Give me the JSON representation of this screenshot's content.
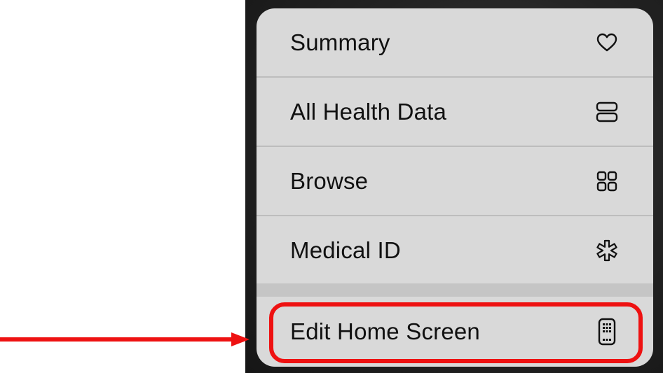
{
  "menu": {
    "items": [
      {
        "label": "Summary",
        "icon": "heart-icon"
      },
      {
        "label": "All Health Data",
        "icon": "stacked-rows-icon"
      },
      {
        "label": "Browse",
        "icon": "grid-icon"
      },
      {
        "label": "Medical ID",
        "icon": "medical-star-icon"
      }
    ],
    "action": {
      "label": "Edit Home Screen",
      "icon": "phone-icon"
    }
  },
  "annotation": {
    "color": "#ee1111",
    "target": "Edit Home Screen"
  }
}
